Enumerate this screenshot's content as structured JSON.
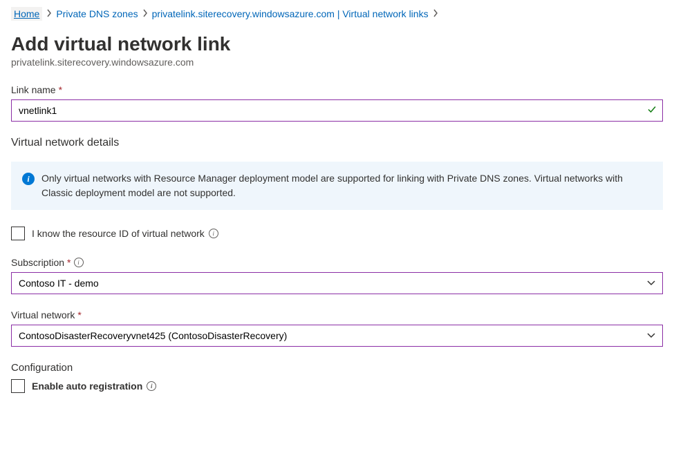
{
  "breadcrumb": {
    "home": "Home",
    "zones": "Private DNS zones",
    "zone_links": "privatelink.siterecovery.windowsazure.com | Virtual network links"
  },
  "header": {
    "title": "Add virtual network link",
    "subtitle": "privatelink.siterecovery.windowsazure.com"
  },
  "link_name": {
    "label": "Link name",
    "value": "vnetlink1"
  },
  "vnet_details_header": "Virtual network details",
  "info_message": "Only virtual networks with Resource Manager deployment model are supported for linking with Private DNS zones. Virtual networks with Classic deployment model are not supported.",
  "resource_id_checkbox": {
    "label": "I know the resource ID of virtual network"
  },
  "subscription": {
    "label": "Subscription",
    "value": "Contoso IT - demo"
  },
  "virtual_network": {
    "label": "Virtual network",
    "value": "ContosoDisasterRecoveryvnet425 (ContosoDisasterRecovery)"
  },
  "configuration": {
    "header": "Configuration",
    "auto_reg_label": "Enable auto registration"
  }
}
